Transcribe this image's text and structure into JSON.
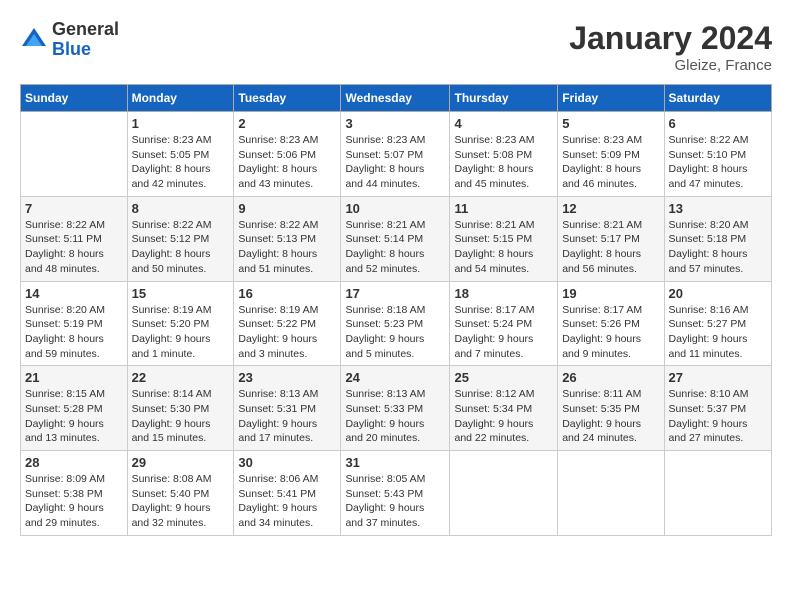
{
  "header": {
    "logo": {
      "general": "General",
      "blue": "Blue"
    },
    "title": "January 2024",
    "location": "Gleize, France"
  },
  "weekdays": [
    "Sunday",
    "Monday",
    "Tuesday",
    "Wednesday",
    "Thursday",
    "Friday",
    "Saturday"
  ],
  "weeks": [
    [
      {
        "day": "",
        "sunrise": "",
        "sunset": "",
        "daylight": ""
      },
      {
        "day": "1",
        "sunrise": "Sunrise: 8:23 AM",
        "sunset": "Sunset: 5:05 PM",
        "daylight": "Daylight: 8 hours and 42 minutes."
      },
      {
        "day": "2",
        "sunrise": "Sunrise: 8:23 AM",
        "sunset": "Sunset: 5:06 PM",
        "daylight": "Daylight: 8 hours and 43 minutes."
      },
      {
        "day": "3",
        "sunrise": "Sunrise: 8:23 AM",
        "sunset": "Sunset: 5:07 PM",
        "daylight": "Daylight: 8 hours and 44 minutes."
      },
      {
        "day": "4",
        "sunrise": "Sunrise: 8:23 AM",
        "sunset": "Sunset: 5:08 PM",
        "daylight": "Daylight: 8 hours and 45 minutes."
      },
      {
        "day": "5",
        "sunrise": "Sunrise: 8:23 AM",
        "sunset": "Sunset: 5:09 PM",
        "daylight": "Daylight: 8 hours and 46 minutes."
      },
      {
        "day": "6",
        "sunrise": "Sunrise: 8:22 AM",
        "sunset": "Sunset: 5:10 PM",
        "daylight": "Daylight: 8 hours and 47 minutes."
      }
    ],
    [
      {
        "day": "7",
        "sunrise": "Sunrise: 8:22 AM",
        "sunset": "Sunset: 5:11 PM",
        "daylight": "Daylight: 8 hours and 48 minutes."
      },
      {
        "day": "8",
        "sunrise": "Sunrise: 8:22 AM",
        "sunset": "Sunset: 5:12 PM",
        "daylight": "Daylight: 8 hours and 50 minutes."
      },
      {
        "day": "9",
        "sunrise": "Sunrise: 8:22 AM",
        "sunset": "Sunset: 5:13 PM",
        "daylight": "Daylight: 8 hours and 51 minutes."
      },
      {
        "day": "10",
        "sunrise": "Sunrise: 8:21 AM",
        "sunset": "Sunset: 5:14 PM",
        "daylight": "Daylight: 8 hours and 52 minutes."
      },
      {
        "day": "11",
        "sunrise": "Sunrise: 8:21 AM",
        "sunset": "Sunset: 5:15 PM",
        "daylight": "Daylight: 8 hours and 54 minutes."
      },
      {
        "day": "12",
        "sunrise": "Sunrise: 8:21 AM",
        "sunset": "Sunset: 5:17 PM",
        "daylight": "Daylight: 8 hours and 56 minutes."
      },
      {
        "day": "13",
        "sunrise": "Sunrise: 8:20 AM",
        "sunset": "Sunset: 5:18 PM",
        "daylight": "Daylight: 8 hours and 57 minutes."
      }
    ],
    [
      {
        "day": "14",
        "sunrise": "Sunrise: 8:20 AM",
        "sunset": "Sunset: 5:19 PM",
        "daylight": "Daylight: 8 hours and 59 minutes."
      },
      {
        "day": "15",
        "sunrise": "Sunrise: 8:19 AM",
        "sunset": "Sunset: 5:20 PM",
        "daylight": "Daylight: 9 hours and 1 minute."
      },
      {
        "day": "16",
        "sunrise": "Sunrise: 8:19 AM",
        "sunset": "Sunset: 5:22 PM",
        "daylight": "Daylight: 9 hours and 3 minutes."
      },
      {
        "day": "17",
        "sunrise": "Sunrise: 8:18 AM",
        "sunset": "Sunset: 5:23 PM",
        "daylight": "Daylight: 9 hours and 5 minutes."
      },
      {
        "day": "18",
        "sunrise": "Sunrise: 8:17 AM",
        "sunset": "Sunset: 5:24 PM",
        "daylight": "Daylight: 9 hours and 7 minutes."
      },
      {
        "day": "19",
        "sunrise": "Sunrise: 8:17 AM",
        "sunset": "Sunset: 5:26 PM",
        "daylight": "Daylight: 9 hours and 9 minutes."
      },
      {
        "day": "20",
        "sunrise": "Sunrise: 8:16 AM",
        "sunset": "Sunset: 5:27 PM",
        "daylight": "Daylight: 9 hours and 11 minutes."
      }
    ],
    [
      {
        "day": "21",
        "sunrise": "Sunrise: 8:15 AM",
        "sunset": "Sunset: 5:28 PM",
        "daylight": "Daylight: 9 hours and 13 minutes."
      },
      {
        "day": "22",
        "sunrise": "Sunrise: 8:14 AM",
        "sunset": "Sunset: 5:30 PM",
        "daylight": "Daylight: 9 hours and 15 minutes."
      },
      {
        "day": "23",
        "sunrise": "Sunrise: 8:13 AM",
        "sunset": "Sunset: 5:31 PM",
        "daylight": "Daylight: 9 hours and 17 minutes."
      },
      {
        "day": "24",
        "sunrise": "Sunrise: 8:13 AM",
        "sunset": "Sunset: 5:33 PM",
        "daylight": "Daylight: 9 hours and 20 minutes."
      },
      {
        "day": "25",
        "sunrise": "Sunrise: 8:12 AM",
        "sunset": "Sunset: 5:34 PM",
        "daylight": "Daylight: 9 hours and 22 minutes."
      },
      {
        "day": "26",
        "sunrise": "Sunrise: 8:11 AM",
        "sunset": "Sunset: 5:35 PM",
        "daylight": "Daylight: 9 hours and 24 minutes."
      },
      {
        "day": "27",
        "sunrise": "Sunrise: 8:10 AM",
        "sunset": "Sunset: 5:37 PM",
        "daylight": "Daylight: 9 hours and 27 minutes."
      }
    ],
    [
      {
        "day": "28",
        "sunrise": "Sunrise: 8:09 AM",
        "sunset": "Sunset: 5:38 PM",
        "daylight": "Daylight: 9 hours and 29 minutes."
      },
      {
        "day": "29",
        "sunrise": "Sunrise: 8:08 AM",
        "sunset": "Sunset: 5:40 PM",
        "daylight": "Daylight: 9 hours and 32 minutes."
      },
      {
        "day": "30",
        "sunrise": "Sunrise: 8:06 AM",
        "sunset": "Sunset: 5:41 PM",
        "daylight": "Daylight: 9 hours and 34 minutes."
      },
      {
        "day": "31",
        "sunrise": "Sunrise: 8:05 AM",
        "sunset": "Sunset: 5:43 PM",
        "daylight": "Daylight: 9 hours and 37 minutes."
      },
      {
        "day": "",
        "sunrise": "",
        "sunset": "",
        "daylight": ""
      },
      {
        "day": "",
        "sunrise": "",
        "sunset": "",
        "daylight": ""
      },
      {
        "day": "",
        "sunrise": "",
        "sunset": "",
        "daylight": ""
      }
    ]
  ]
}
